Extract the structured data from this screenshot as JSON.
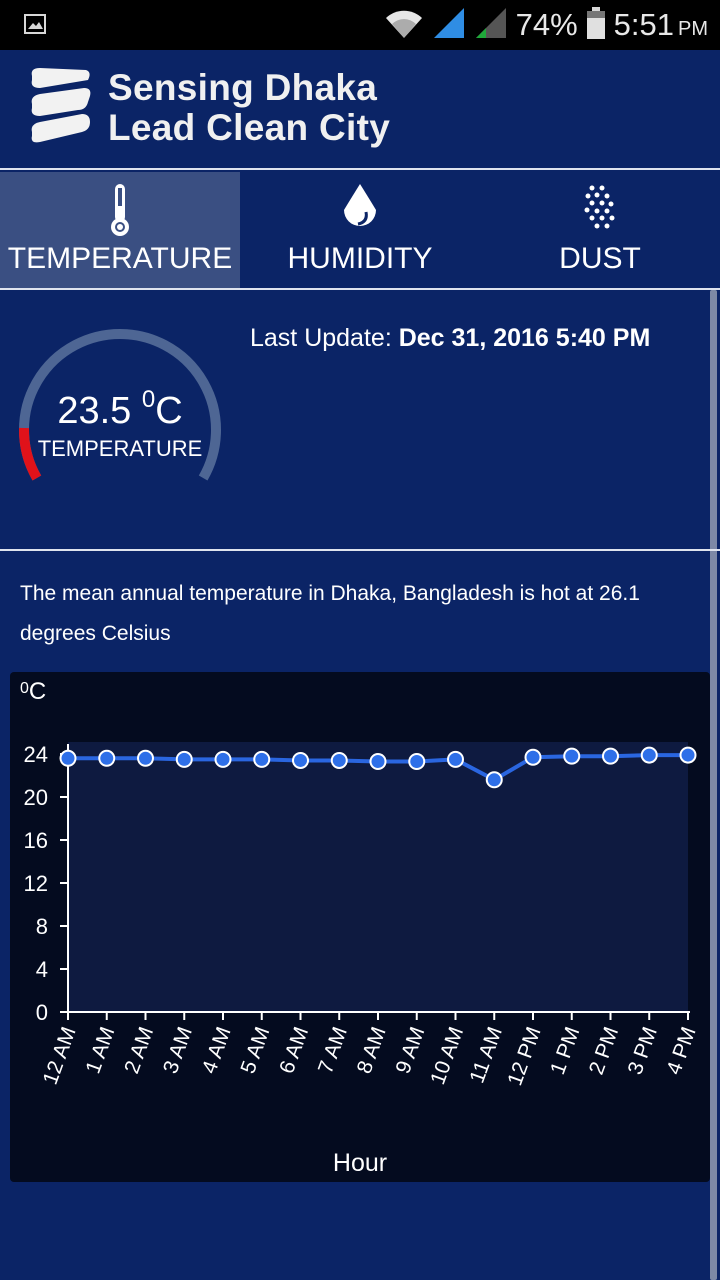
{
  "status_bar": {
    "battery": "74%",
    "time": "5:51",
    "ampm": "PM",
    "icons": [
      "image-icon",
      "wifi-icon",
      "signal-icon",
      "signal-icon-2",
      "battery-icon"
    ]
  },
  "header": {
    "title_line1": "Sensing Dhaka",
    "title_line2": "Lead Clean City",
    "logo_icon": "stripes-logo-icon"
  },
  "tabs": [
    {
      "label": "TEMPERATURE",
      "icon": "thermometer-icon",
      "active": true
    },
    {
      "label": "HUMIDITY",
      "icon": "droplet-icon",
      "active": false
    },
    {
      "label": "DUST",
      "icon": "dust-icon",
      "active": false
    }
  ],
  "gauge": {
    "value": "23.5",
    "unit_sup": "0",
    "unit": "C",
    "label": "TEMPERATURE",
    "fill_fraction": 0.13,
    "fill_color": "#e0121a",
    "track_color": "#4e6694"
  },
  "last_update": {
    "label": "Last Update: ",
    "value": "Dec 31, 2016 5:40 PM"
  },
  "description": "The mean annual temperature in Dhaka, Bangladesh is hot at 26.1 degrees Celsius",
  "chart_data": {
    "type": "line",
    "ylabel_sup": "0",
    "ylabel": "C",
    "xlabel": "Hour",
    "categories": [
      "12 AM",
      "1 AM",
      "2 AM",
      "3 AM",
      "4 AM",
      "5 AM",
      "6 AM",
      "7 AM",
      "8 AM",
      "9 AM",
      "10 AM",
      "11 AM",
      "12 PM",
      "1 PM",
      "2 PM",
      "3 PM",
      "4 PM"
    ],
    "values": [
      23.6,
      23.6,
      23.6,
      23.5,
      23.5,
      23.5,
      23.4,
      23.4,
      23.3,
      23.3,
      23.5,
      21.6,
      23.7,
      23.8,
      23.8,
      23.9,
      23.9
    ],
    "yticks": [
      0,
      4,
      8,
      12,
      16,
      20,
      24
    ],
    "ylim": [
      0,
      24
    ],
    "line_color": "#2a66e0",
    "point_color": "#2e6fe8",
    "plot_bg": "#0e1a40"
  }
}
